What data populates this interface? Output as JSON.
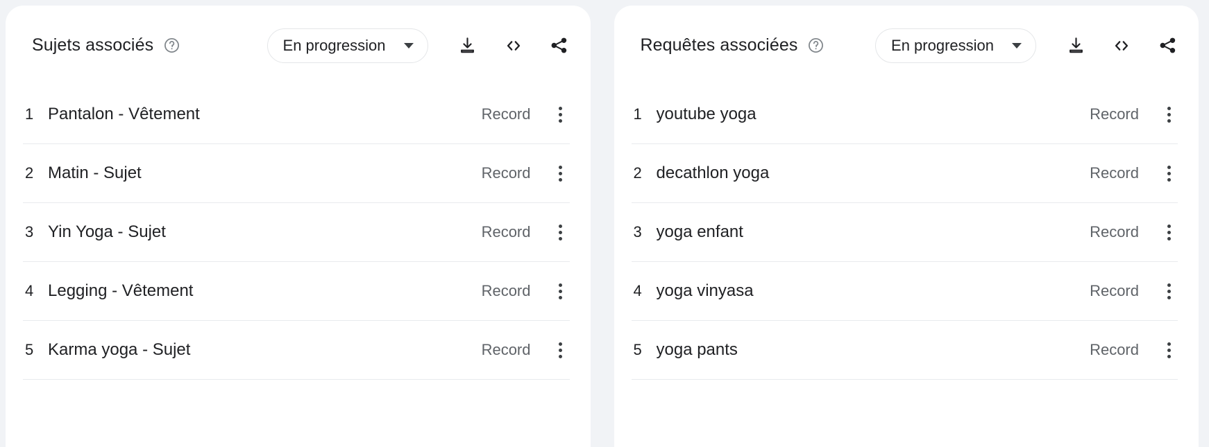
{
  "background_color": "#f1f3f6",
  "card_color": "#ffffff",
  "text_color": "#202124",
  "muted_text_color": "#5f6368",
  "divider_color": "#e8eaed",
  "panels": [
    {
      "id": "related-topics",
      "title": "Sujets associés",
      "help_icon": "help-circle-icon",
      "filter": {
        "label": "En progression",
        "caret_icon": "chevron-down-icon"
      },
      "actions": [
        {
          "name": "download-icon",
          "label": "Download"
        },
        {
          "name": "embed-code-icon",
          "label": "<>"
        },
        {
          "name": "share-icon",
          "label": "Share"
        }
      ],
      "rows": [
        {
          "rank": "1",
          "label": "Pantalon - Vêtement",
          "value": "Record"
        },
        {
          "rank": "2",
          "label": "Matin - Sujet",
          "value": "Record"
        },
        {
          "rank": "3",
          "label": "Yin Yoga - Sujet",
          "value": "Record"
        },
        {
          "rank": "4",
          "label": "Legging - Vêtement",
          "value": "Record"
        },
        {
          "rank": "5",
          "label": "Karma yoga - Sujet",
          "value": "Record"
        }
      ]
    },
    {
      "id": "related-queries",
      "title": "Requêtes associées",
      "help_icon": "help-circle-icon",
      "filter": {
        "label": "En progression",
        "caret_icon": "chevron-down-icon"
      },
      "actions": [
        {
          "name": "download-icon",
          "label": "Download"
        },
        {
          "name": "embed-code-icon",
          "label": "<>"
        },
        {
          "name": "share-icon",
          "label": "Share"
        }
      ],
      "rows": [
        {
          "rank": "1",
          "label": "youtube yoga",
          "value": "Record"
        },
        {
          "rank": "2",
          "label": "decathlon yoga",
          "value": "Record"
        },
        {
          "rank": "3",
          "label": "yoga enfant",
          "value": "Record"
        },
        {
          "rank": "4",
          "label": "yoga vinyasa",
          "value": "Record"
        },
        {
          "rank": "5",
          "label": "yoga pants",
          "value": "Record"
        }
      ]
    }
  ]
}
